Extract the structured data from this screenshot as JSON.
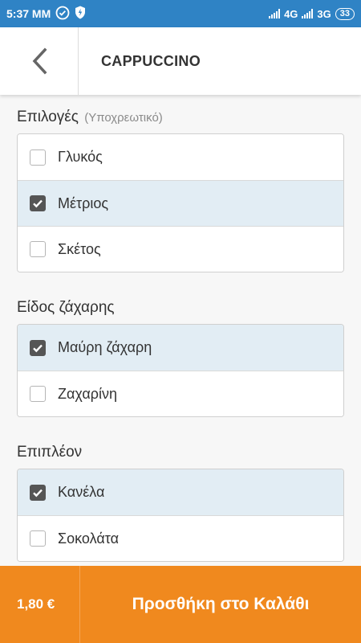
{
  "status": {
    "time": "5:37 MM",
    "net1": "4G",
    "net2": "3G",
    "battery": "33"
  },
  "appbar": {
    "title": "CAPPUCCINO"
  },
  "sections": [
    {
      "title": "Επιλογές",
      "subtitle": "(Υποχρεωτικό)",
      "options": [
        {
          "label": "Γλυκός",
          "checked": false
        },
        {
          "label": "Μέτριος",
          "checked": true
        },
        {
          "label": "Σκέτος",
          "checked": false
        }
      ]
    },
    {
      "title": "Είδος ζάχαρης",
      "options": [
        {
          "label": "Μαύρη ζάχαρη",
          "checked": true
        },
        {
          "label": "Ζαχαρίνη",
          "checked": false
        }
      ]
    },
    {
      "title": "Επιπλέον",
      "options": [
        {
          "label": "Κανέλα",
          "checked": true
        },
        {
          "label": "Σοκολάτα",
          "checked": false
        }
      ]
    }
  ],
  "bottom": {
    "price": "1,80 €",
    "cart_label": "Προσθήκη στο Καλάθι"
  },
  "colors": {
    "statusbar": "#2f83c5",
    "accent": "#f0891e",
    "checked_row": "#e2edf4"
  }
}
